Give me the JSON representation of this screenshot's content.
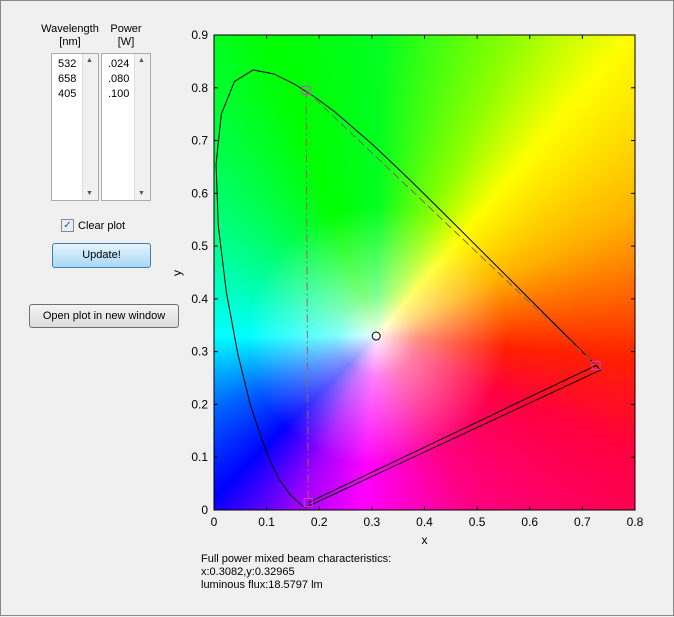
{
  "controls": {
    "wavelength_header": "Wavelength",
    "wavelength_unit": "[nm]",
    "power_header": "Power",
    "power_unit": "[W]",
    "wavelengths": [
      "532",
      "658",
      "405"
    ],
    "powers": [
      ".024",
      ".080",
      ".100"
    ],
    "clear_plot_label": "Clear plot",
    "clear_plot_checked": true,
    "update_label": "Update!",
    "open_label": "Open plot in new window"
  },
  "info": {
    "line1": "Full power mixed beam characteristics:",
    "line2": "x:0.3082,y:0.32965",
    "line3": "luminous flux:18.5797 lm"
  },
  "chart_data": {
    "type": "scatter",
    "title": "",
    "xlabel": "x",
    "ylabel": "y",
    "xlim": [
      0,
      0.8
    ],
    "ylim": [
      0,
      0.9
    ],
    "xticks": [
      "0",
      "0.1",
      "0.2",
      "0.3",
      "0.4",
      "0.5",
      "0.6",
      "0.7",
      "0.8"
    ],
    "yticks": [
      "0",
      "0.1",
      "0.2",
      "0.3",
      "0.4",
      "0.5",
      "0.6",
      "0.7",
      "0.8",
      "0.9"
    ],
    "spectral_locus": [
      [
        0.1741,
        0.005
      ],
      [
        0.1733,
        0.0048
      ],
      [
        0.1714,
        0.0051
      ],
      [
        0.1644,
        0.0109
      ],
      [
        0.1566,
        0.0177
      ],
      [
        0.144,
        0.0297
      ],
      [
        0.1241,
        0.0578
      ],
      [
        0.1096,
        0.0868
      ],
      [
        0.0913,
        0.1327
      ],
      [
        0.0687,
        0.2007
      ],
      [
        0.0454,
        0.295
      ],
      [
        0.0235,
        0.4127
      ],
      [
        0.0082,
        0.5384
      ],
      [
        0.0039,
        0.6548
      ],
      [
        0.0139,
        0.7502
      ],
      [
        0.0389,
        0.812
      ],
      [
        0.0743,
        0.8338
      ],
      [
        0.1142,
        0.8262
      ],
      [
        0.1547,
        0.8059
      ],
      [
        0.1929,
        0.7816
      ],
      [
        0.2296,
        0.7543
      ],
      [
        0.3016,
        0.6923
      ],
      [
        0.3731,
        0.6245
      ],
      [
        0.4441,
        0.5547
      ],
      [
        0.5125,
        0.4866
      ],
      [
        0.5752,
        0.4242
      ],
      [
        0.627,
        0.3725
      ],
      [
        0.6915,
        0.3083
      ],
      [
        0.719,
        0.2809
      ],
      [
        0.73,
        0.27
      ],
      [
        0.7347,
        0.2653
      ]
    ],
    "sources": [
      {
        "wavelength": 532,
        "x": 0.175,
        "y": 0.795
      },
      {
        "wavelength": 658,
        "x": 0.726,
        "y": 0.274
      },
      {
        "wavelength": 405,
        "x": 0.179,
        "y": 0.014
      }
    ],
    "mixed_point": {
      "x": 0.3082,
      "y": 0.32965
    },
    "marker_color": "#d040d0"
  }
}
